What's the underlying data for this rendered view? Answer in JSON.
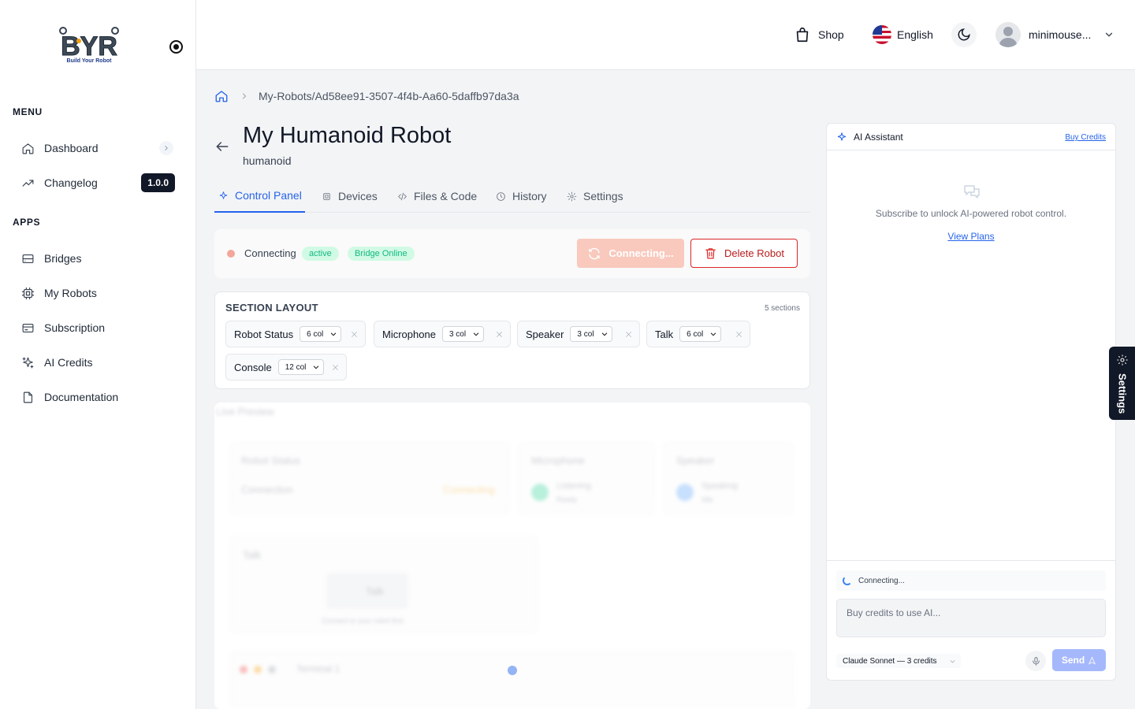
{
  "brand": {
    "logo_text": "BYR",
    "tagline": "Build Your Robot"
  },
  "sidebar": {
    "menu_heading": "MENU",
    "apps_heading": "APPS",
    "menu_items": [
      {
        "label": "Dashboard",
        "icon": "home-icon"
      },
      {
        "label": "Changelog",
        "icon": "trending-icon",
        "badge": "1.0.0"
      }
    ],
    "app_items": [
      {
        "label": "Bridges",
        "icon": "server-icon"
      },
      {
        "label": "My Robots",
        "icon": "chip-icon"
      },
      {
        "label": "Subscription",
        "icon": "credit-card-icon"
      },
      {
        "label": "AI Credits",
        "icon": "sparkle-icon"
      },
      {
        "label": "Documentation",
        "icon": "file-icon"
      }
    ]
  },
  "header": {
    "shop_label": "Shop",
    "language_label": "English",
    "username": "minimouse..."
  },
  "breadcrumb": {
    "path": "My-Robots/Ad58ee91-3507-4f4b-Aa60-5daffb97da3a"
  },
  "robot": {
    "title": "My Humanoid Robot",
    "type": "humanoid"
  },
  "tabs": [
    {
      "label": "Control Panel",
      "active": true
    },
    {
      "label": "Devices",
      "active": false
    },
    {
      "label": "Files & Code",
      "active": false
    },
    {
      "label": "History",
      "active": false
    },
    {
      "label": "Settings",
      "active": false
    }
  ],
  "status": {
    "text": "Connecting",
    "badge_active": "active",
    "badge_bridge": "Bridge Online",
    "connect_button": "Connecting...",
    "delete_button": "Delete Robot"
  },
  "section_layout": {
    "title": "SECTION LAYOUT",
    "count": "5 sections",
    "sections": [
      {
        "name": "Robot Status",
        "cols": "6 col"
      },
      {
        "name": "Microphone",
        "cols": "3 col"
      },
      {
        "name": "Speaker",
        "cols": "3 col"
      },
      {
        "name": "Talk",
        "cols": "6 col"
      },
      {
        "name": "Console",
        "cols": "12 col"
      }
    ]
  },
  "preview": {
    "title": "Live Preview",
    "robot_status": "Robot Status",
    "connection": "Connection",
    "connection_value": "Connecting",
    "microphone": "Microphone",
    "mic_state": "Listening",
    "mic_sub": "Ready",
    "speaker": "Speaker",
    "speaker_state": "Speaking",
    "speaker_sub": "Idle",
    "talk": "Talk",
    "talk_button": "Talk",
    "talk_hint": "Connect to your robot first",
    "terminal": "Terminal 1"
  },
  "ai_assistant": {
    "title": "AI Assistant",
    "buy_credits": "Buy Credits",
    "subscribe_text": "Subscribe to unlock AI-powered robot control.",
    "view_plans": "View Plans",
    "connection_status": "Connecting...",
    "input_placeholder": "Buy credits to use AI...",
    "model": "Claude Sonnet — 3 credits",
    "send": "Send"
  },
  "floating_settings": "Settings",
  "colors": {
    "accent": "#2563eb",
    "danger": "#dc2626",
    "success_bg": "#d1fae5",
    "success_text": "#10b981",
    "dark": "#111827"
  }
}
